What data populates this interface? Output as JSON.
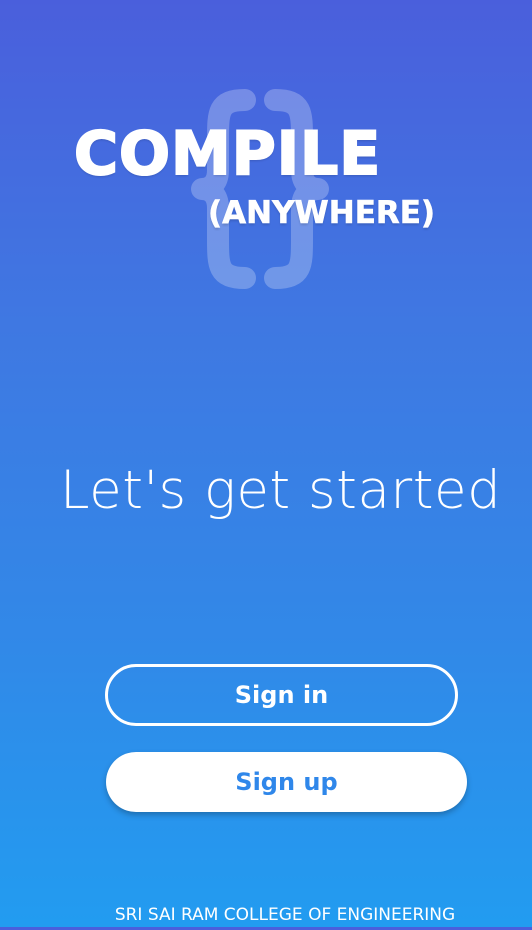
{
  "logo": {
    "title": "COMPILE",
    "subtitle": "(ANYWHERE)",
    "icon": "curly-braces-icon"
  },
  "headline": "Let's get started",
  "buttons": {
    "signin_label": "Sign in",
    "signup_label": "Sign up"
  },
  "footer": "SRI SAI RAM COLLEGE OF ENGINEERING",
  "colors": {
    "background_top": "#4a5fdc",
    "background_bottom": "#229cf0",
    "text": "#ffffff",
    "signup_text": "#2f87ea"
  }
}
